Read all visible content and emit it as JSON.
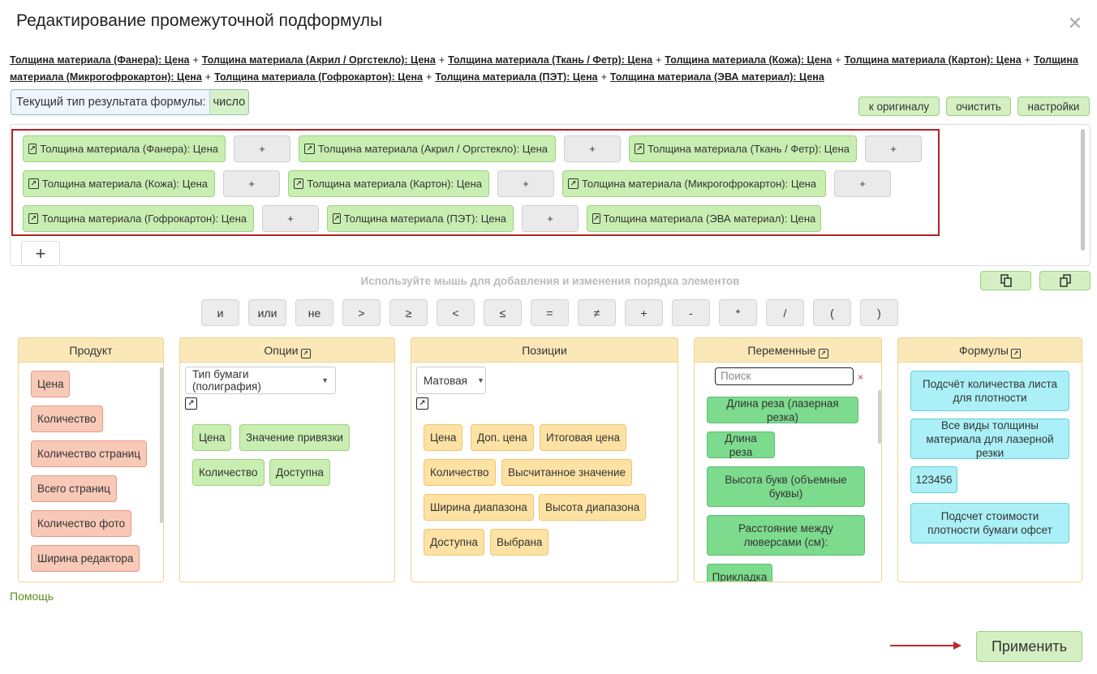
{
  "dialog": {
    "title": "Редактирование промежуточной подформулы",
    "close_icon": "close-icon"
  },
  "formula_text": {
    "terms": [
      "Толщина материала (Фанера): Цена",
      "Толщина материала (Акрил / Оргстекло): Цена",
      "Толщина материала (Ткань / Фетр): Цена",
      "Толщина материала (Кожа): Цена",
      "Толщина материала (Картон): Цена",
      "Толщина материала (Микрогофрокартон): Цена",
      "Толщина материала (Гофрокартон): Цена",
      "Толщина материала (ПЭТ): Цена",
      "Толщина материала (ЭВА материал): Цена"
    ],
    "operator": "+"
  },
  "result_type": {
    "label": "Текущий тип результата формулы:",
    "value": "число"
  },
  "toolbar": {
    "to_original": "к оригиналу",
    "clear": "очистить",
    "settings": "настройки"
  },
  "editor": {
    "chips": [
      "Толщина материала (Фанера): Цена",
      "+",
      "Толщина материала (Акрил / Оргстекло): Цена",
      "+",
      "Толщина материала (Ткань / Фетр): Цена",
      "+",
      "Толщина материала (Кожа): Цена",
      "+",
      "Толщина материала (Картон): Цена",
      "+",
      "Толщина материала (Микрогофрокартон): Цена",
      "+",
      "Толщина материала (Гофрокартон): Цена",
      "+",
      "Толщина материала (ПЭТ): Цена",
      "+",
      "Толщина материала (ЭВА материал): Цена"
    ],
    "add_label": "+",
    "hint": "Используйте мышь для добавления и изменения порядка элементов"
  },
  "operators": [
    "и",
    "или",
    "не",
    ">",
    "≥",
    "<",
    "≤",
    "=",
    "≠",
    "+",
    "-",
    "*",
    "/",
    "(",
    ")"
  ],
  "panels": {
    "product": {
      "title": "Продукт",
      "items": [
        "Цена",
        "Количество",
        "Количество страниц",
        "Всего страниц",
        "Количество фото",
        "Ширина редактора"
      ]
    },
    "options": {
      "title": "Опции",
      "select_value": "Тип бумаги (полиграфия)",
      "items": [
        "Цена",
        "Значение привязки",
        "Количество",
        "Доступна"
      ]
    },
    "positions": {
      "title": "Позиции",
      "select_value": "Матовая",
      "items": [
        "Цена",
        "Доп. цена",
        "Итоговая цена",
        "Количество",
        "Высчитанное значение",
        "Ширина диапазона",
        "Высота диапазона",
        "Доступна",
        "Выбрана"
      ]
    },
    "variables": {
      "title": "Переменные",
      "search_placeholder": "Поиск",
      "items": [
        "Длина реза (лазерная резка)",
        "Длина реза",
        "Высота букв (объемные буквы)",
        "Расстояние между люверсами (см):",
        "Прикладка"
      ]
    },
    "formulas": {
      "title": "Формулы",
      "items": [
        "Подсчёт количества листа для плотности",
        "Все виды толщины материала для лазерной резки",
        "123456",
        "Подсчет стоимости плотности бумаги офсет"
      ]
    }
  },
  "footer": {
    "help": "Помощь",
    "apply": "Применить"
  },
  "colors": {
    "accent_green": "#d4f0c2",
    "selection_border": "#b22222",
    "panel_header": "#fbe8b8"
  }
}
